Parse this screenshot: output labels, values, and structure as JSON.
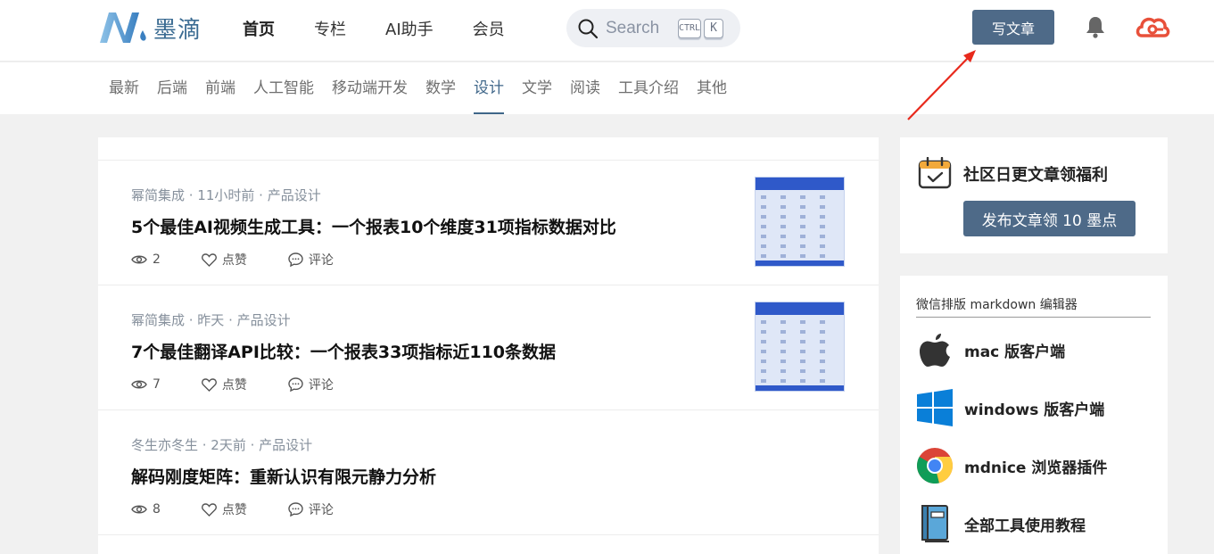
{
  "header": {
    "logo_text": "墨滴",
    "nav": [
      "首页",
      "专栏",
      "AI助手",
      "会员"
    ],
    "active_nav": "首页",
    "search": {
      "placeholder": "Search",
      "shortcut_ctrl": "CTRL",
      "shortcut_key": "K"
    },
    "write_button": "写文章",
    "icons": {
      "bell": "bell-icon",
      "avatar": "cloud-avatar-icon"
    },
    "colors": {
      "brand": "#4e6a88",
      "accent": "#3f6689",
      "avatar": "#e8503a"
    }
  },
  "categories": {
    "items": [
      "最新",
      "后端",
      "前端",
      "人工智能",
      "移动端开发",
      "数学",
      "设计",
      "文学",
      "阅读",
      "工具介绍",
      "其他"
    ],
    "active": "设计"
  },
  "articles": [
    {
      "meta": "幂简集成 · 11小时前 · 产品设计",
      "title": "5个最佳AI视频生成工具：一个报表10个维度31项指标数据对比",
      "views": "2",
      "like_label": "点赞",
      "comment_label": "评论",
      "has_thumb": true
    },
    {
      "meta": "幂简集成 · 昨天 · 产品设计",
      "title": "7个最佳翻译API比较：一个报表33项指标近110条数据",
      "views": "7",
      "like_label": "点赞",
      "comment_label": "评论",
      "has_thumb": true
    },
    {
      "meta": "冬生亦冬生 · 2天前 · 产品设计",
      "title": "解码刚度矩阵：重新认识有限元静力分析",
      "views": "8",
      "like_label": "点赞",
      "comment_label": "评论",
      "has_thumb": false
    }
  ],
  "sidebar": {
    "promo": {
      "title": "社区日更文章领福利",
      "button": "发布文章领 10 墨点"
    },
    "tools": {
      "heading": "微信排版 markdown 编辑器",
      "items": [
        {
          "label": "mac 版客户端",
          "icon": "apple-icon"
        },
        {
          "label": "windows 版客户端",
          "icon": "windows-icon"
        },
        {
          "label": "mdnice 浏览器插件",
          "icon": "chrome-icon"
        },
        {
          "label": "全部工具使用教程",
          "icon": "book-icon"
        }
      ]
    }
  }
}
